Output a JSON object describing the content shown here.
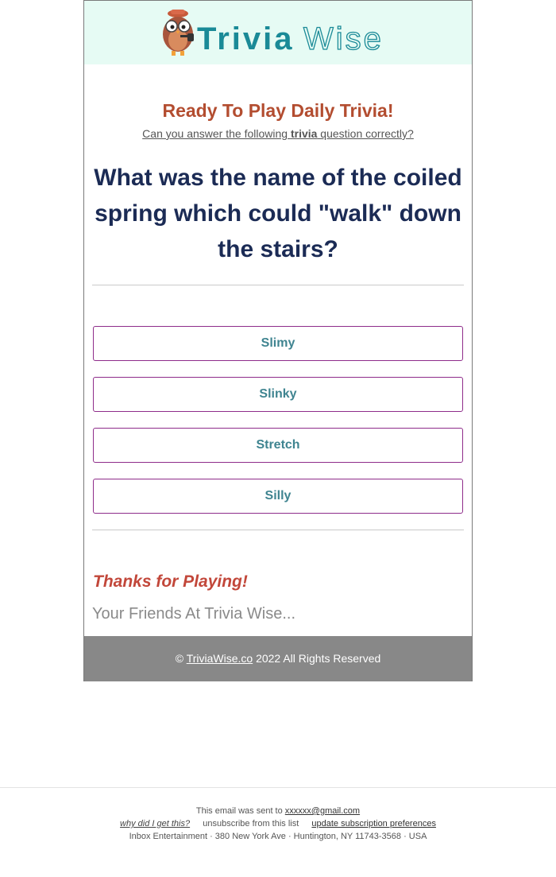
{
  "brand": {
    "name_part1": "Trivia",
    "name_part2": "Wise",
    "icon": "owl-mascot-icon",
    "colors": {
      "teal": "#1a8a97",
      "band": "#e6fbf4"
    }
  },
  "intro": {
    "title": "Ready To Play Daily Trivia!",
    "subtitle_before": "Can you answer the following ",
    "subtitle_bold": "trivia",
    "subtitle_after": " question correctly?"
  },
  "question": {
    "text": "What was the name of the coiled spring which could \"walk\" down the stairs?"
  },
  "answers": [
    "Slimy",
    "Slinky",
    "Stretch",
    "Silly"
  ],
  "closing": {
    "thanks": "Thanks for Playing!",
    "signoff": "Your Friends At Trivia Wise..."
  },
  "footer": {
    "copyright_symbol": "©",
    "site_link": "TriviaWise.co",
    "rights": " 2022 All Rights Reserved"
  },
  "email_info": {
    "sent_to_prefix": "This email was sent to ",
    "email": "xxxxxx@gmail.com",
    "why_link": "why did I get this?",
    "unsubscribe_link": "unsubscribe from this list",
    "preferences_link": "update subscription preferences",
    "address": "Inbox Entertainment · 380 New York Ave · Huntington, NY 11743-3568 · USA"
  }
}
